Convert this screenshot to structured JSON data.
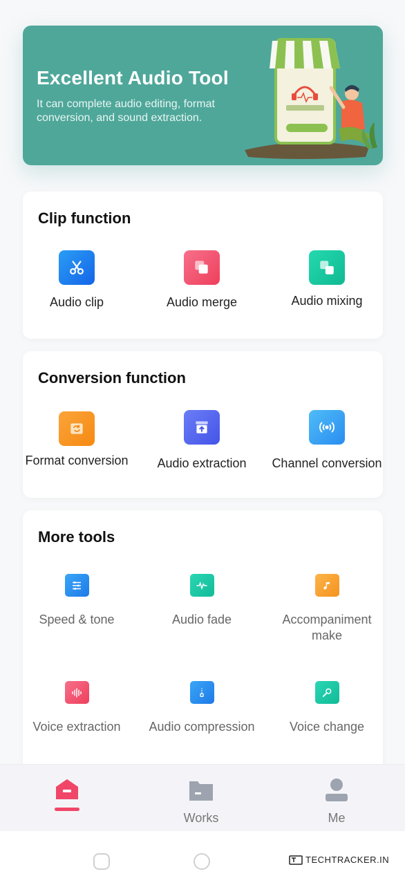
{
  "banner": {
    "title": "Excellent Audio Tool",
    "subtitle": "It can complete audio editing, format conversion, and sound extraction."
  },
  "clip_section": {
    "title": "Clip function",
    "tools": [
      {
        "label": "Audio clip",
        "icon": "scissors-icon",
        "color": "#1e8cf0"
      },
      {
        "label": "Audio merge",
        "icon": "merge-icon",
        "color": "#f2536a"
      },
      {
        "label": "Audio mixing",
        "icon": "mixing-icon",
        "color": "#1ccfa6"
      }
    ]
  },
  "conversion_section": {
    "title": "Conversion function",
    "tools": [
      {
        "label": "Format conversion",
        "icon": "format-convert-icon",
        "color": "#f7931e"
      },
      {
        "label": "Audio extraction",
        "icon": "extraction-icon",
        "color": "#5b6cf2"
      },
      {
        "label": "Channel conversion",
        "icon": "broadcast-icon",
        "color": "#3aa8f5"
      }
    ]
  },
  "more_section": {
    "title": "More tools",
    "tools": [
      {
        "label": "Speed & tone",
        "icon": "sliders-icon",
        "color": "#2a8cf0"
      },
      {
        "label": "Audio fade",
        "icon": "waveform-icon",
        "color": "#1dc9a8"
      },
      {
        "label": "Accompaniment make",
        "icon": "music-note-icon",
        "color": "#f7a632"
      },
      {
        "label": "Voice extraction",
        "icon": "sound-bars-icon",
        "color": "#f25a7a"
      },
      {
        "label": "Audio compression",
        "icon": "zip-icon",
        "color": "#2a8cf0"
      },
      {
        "label": "Voice change",
        "icon": "mic-icon",
        "color": "#1dc9a8"
      }
    ]
  },
  "nav": {
    "items": [
      {
        "label": "",
        "icon": "home-icon",
        "active": true
      },
      {
        "label": "Works",
        "icon": "folder-icon",
        "active": false
      },
      {
        "label": "Me",
        "icon": "user-icon",
        "active": false
      }
    ],
    "accent": "#f04668"
  },
  "watermark": "TECHTRACKER.IN"
}
